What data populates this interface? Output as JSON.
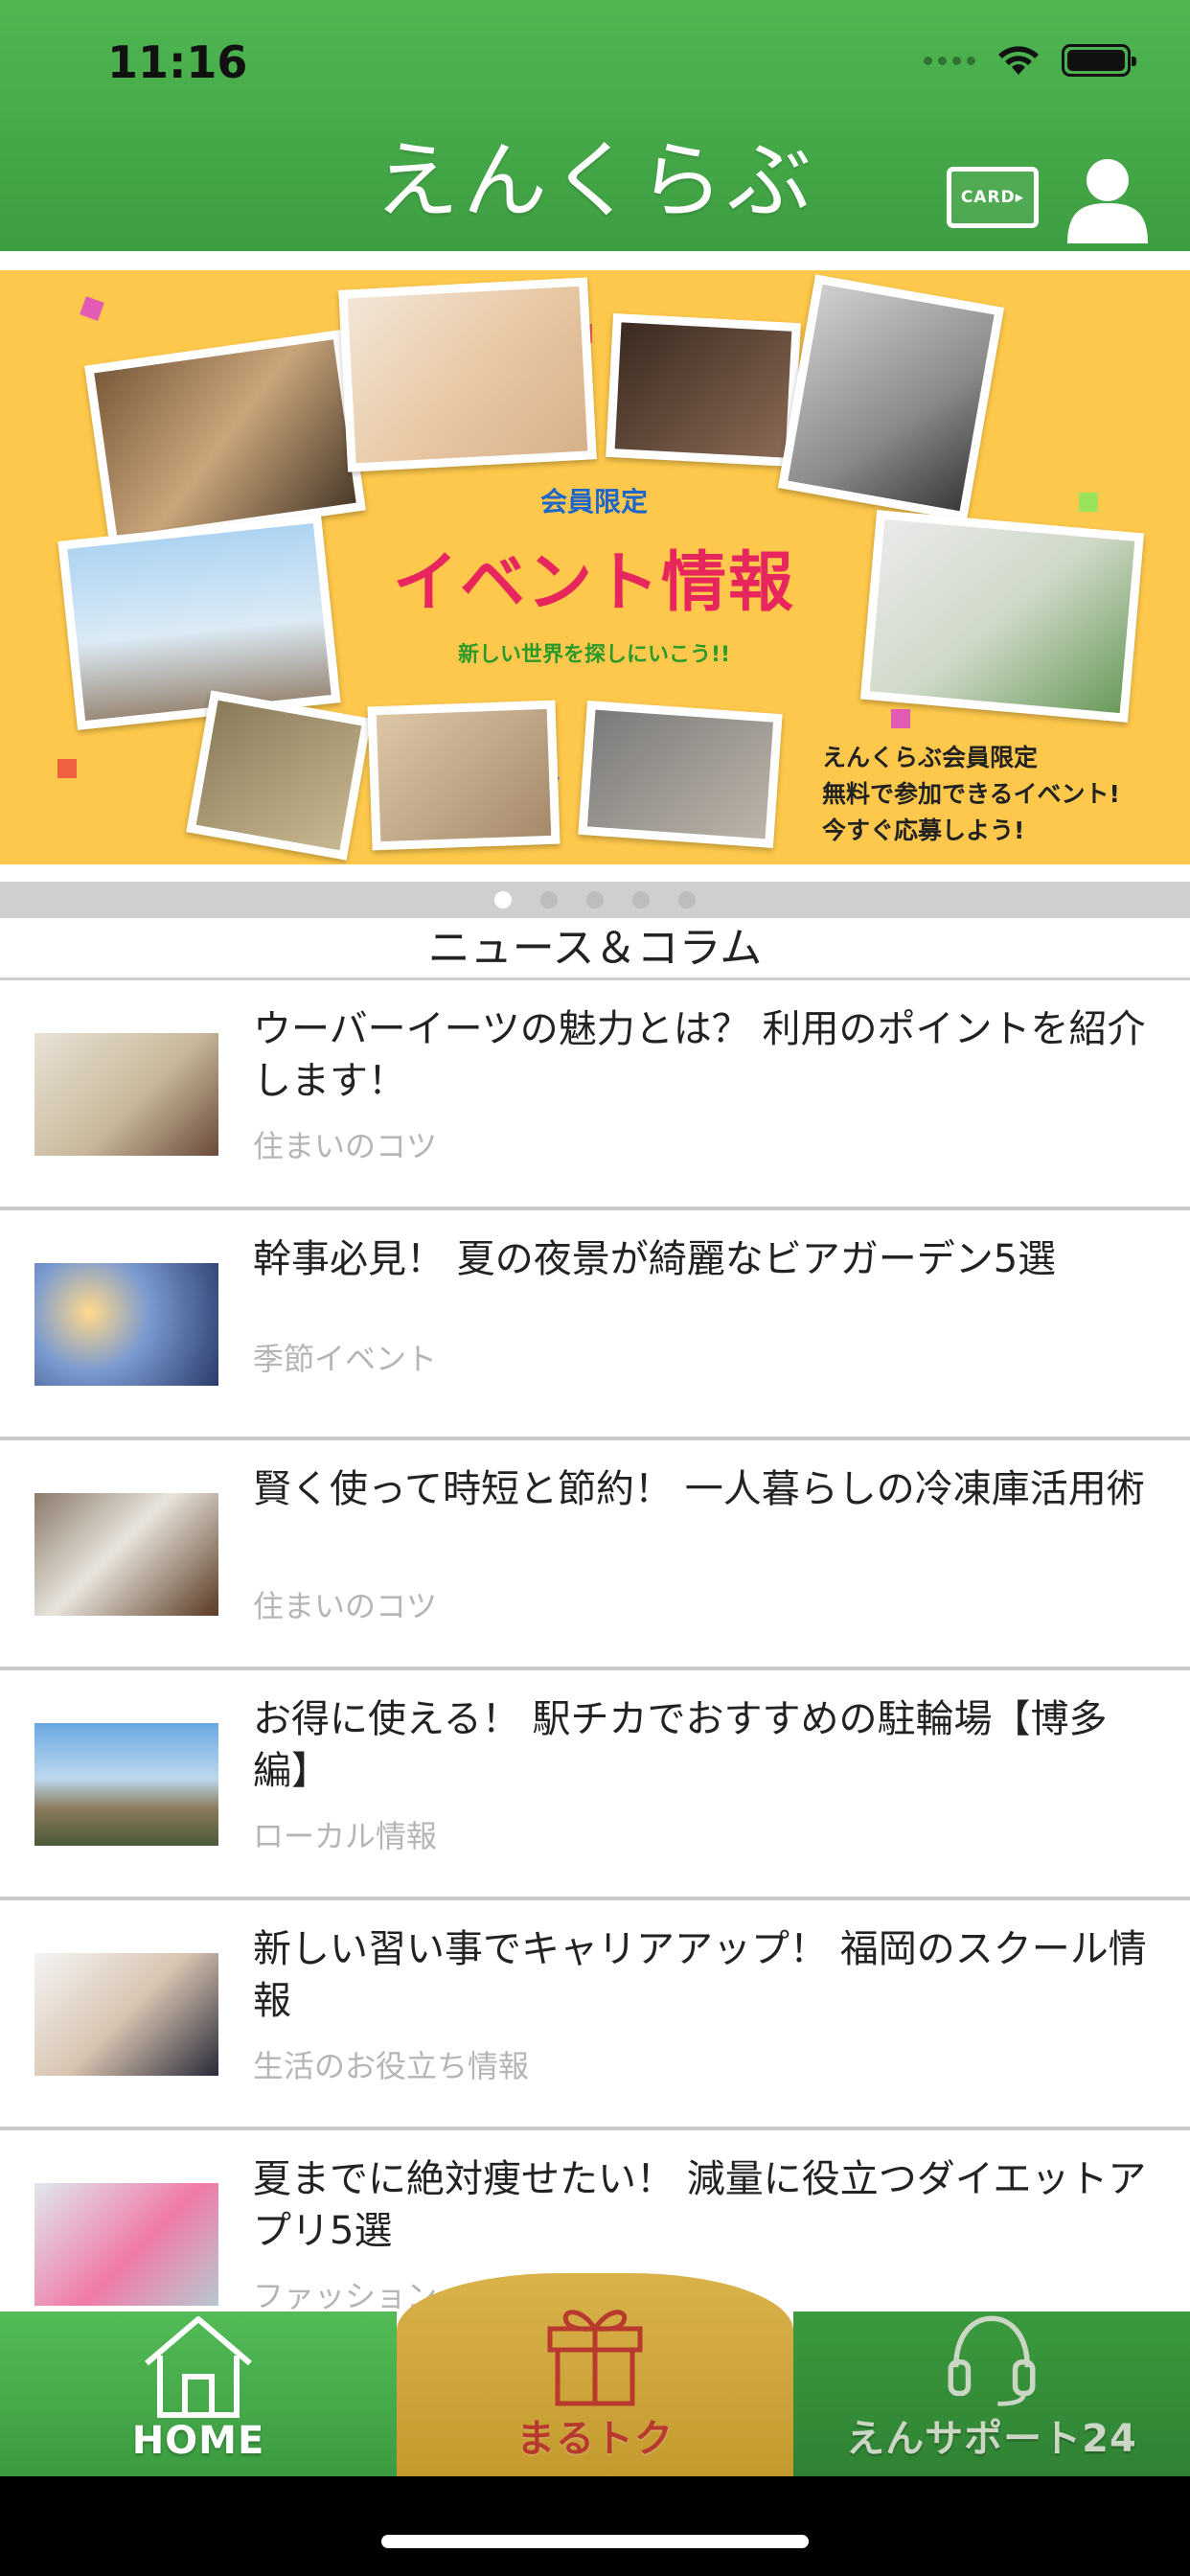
{
  "status": {
    "time": "11:16"
  },
  "header": {
    "title": "えんくらぶ",
    "card_label": "CARD▸"
  },
  "banner": {
    "sub": "会員限定",
    "main": "イベント情報",
    "tagline": "新しい世界を探しにいこう!!",
    "note_lines": [
      "えんくらぶ会員限定",
      "無料で参加できるイベント!",
      "今すぐ応募しよう!"
    ],
    "page_count": 5,
    "active_page": 1
  },
  "section": {
    "title": "ニュース＆コラム"
  },
  "news": [
    {
      "title": "ウーバーイーツの魅力とは？ 利用のポイントを紹介します！",
      "category": "住まいのコツ"
    },
    {
      "title": "幹事必見！ 夏の夜景が綺麗なビアガーデン5選",
      "category": "季節イベント"
    },
    {
      "title": "賢く使って時短と節約！ 一人暮らしの冷凍庫活用術",
      "category": "住まいのコツ"
    },
    {
      "title": "お得に使える！ 駅チカでおすすめの駐輪場【博多編】",
      "category": "ローカル情報"
    },
    {
      "title": "新しい習い事でキャリアアップ！ 福岡のスクール情報",
      "category": "生活のお役立ち情報"
    },
    {
      "title": "夏までに絶対痩せたい！ 減量に役立つダイエットアプリ5選",
      "category": "ファッション"
    }
  ],
  "tabbar": {
    "home": "HOME",
    "marutoku": "まるトク",
    "support": "えんサポート24"
  },
  "colors": {
    "header_green": "#4fb652",
    "banner_yellow": "#fdc84b",
    "banner_pink": "#e8265e",
    "tab_gold": "#d9b24a",
    "tab_red": "#b83a2e",
    "category_gray": "#b5b5b5"
  }
}
